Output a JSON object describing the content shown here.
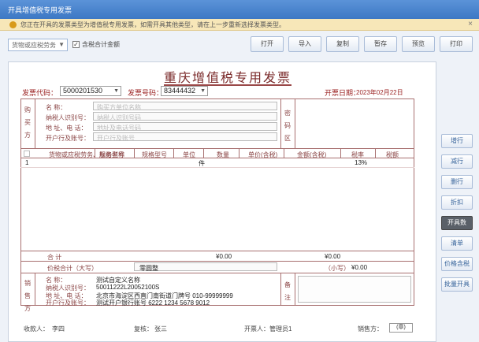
{
  "window": {
    "title": "开具增值税专用发票"
  },
  "notice": {
    "text": "您正在开具的发票类型为增值税专用发票，如需开具其他类型，请在上一步重新选择发票类型。"
  },
  "toolbar": {
    "dropdown_value": "货物或应税劳务",
    "checkbox_label": "含税合计金额",
    "buttons": [
      "打开",
      "导入",
      "复制",
      "暂存",
      "预览",
      "打印"
    ]
  },
  "invoice": {
    "title": "重庆增值税专用发票",
    "code_label": "发票代码：",
    "code_value": "5000201530",
    "number_label": "发票号码：",
    "number_value": "83444432",
    "date_label": "开票日期：",
    "date_value": "2023年02月22日",
    "buyer": {
      "section_label": "购买方",
      "fields": [
        {
          "label": "名        称：",
          "value": "购买方单位名称"
        },
        {
          "label": "纳税人识别号：",
          "value": "纳税人识别号码"
        },
        {
          "label": "地  址、电  话：",
          "value": "地址及电话号码"
        },
        {
          "label": "开户行及账号：",
          "value": "开户行及账号"
        }
      ]
    },
    "password_label": "密码区",
    "items_header": [
      "货物或应税劳务、服务名称",
      "规格型号",
      "单位",
      "数量",
      "单价(含税)",
      "金额(含税)",
      "税率",
      "税额"
    ],
    "item_row": {
      "index": "1",
      "unit": "件",
      "tax_rate": "13%"
    },
    "total_row": {
      "label": "合        计",
      "amount": "¥0.00",
      "tax": "¥0.00"
    },
    "sum_row": {
      "label": "价税合计（大写）",
      "value": "零圆整",
      "small_label": "（小写）",
      "small_value": "¥0.00"
    },
    "seller": {
      "section_label": "销售方",
      "fields": [
        {
          "label": "名        称：",
          "value": "测试自定义名称"
        },
        {
          "label": "纳税人识别号：",
          "value": "50011222L20052100S"
        },
        {
          "label": "地  址、电  话：",
          "value": "北京市海淀区西直门南街道门牌号 010-99999999"
        },
        {
          "label": "开户行及账号：",
          "value": "测试开户银行账号 6222 1234 5678 9012"
        }
      ]
    },
    "remark_label": "备注",
    "payee_label": "收款人：",
    "payee_value": "李四",
    "reviewer_label": "复核：",
    "reviewer_value": "张三",
    "drawer_label": "开票人：",
    "drawer_value": "管理员1",
    "seller_stamp_label": "销售方：",
    "seller_stamp_value": "(章)"
  },
  "side_buttons": [
    "增行",
    "减行",
    "删行",
    "折扣",
    "开具数",
    "清单",
    "价格含税",
    "批量开具"
  ]
}
